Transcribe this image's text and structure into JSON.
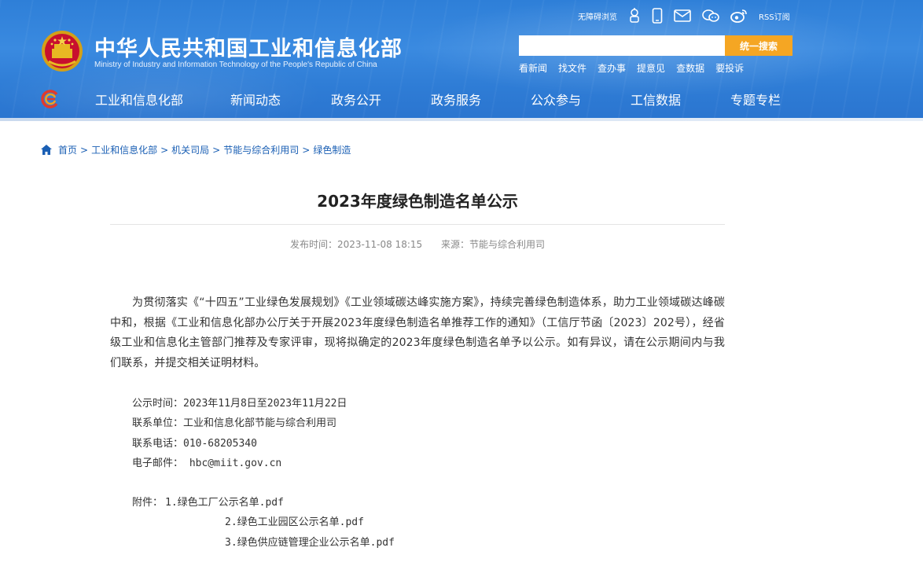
{
  "header": {
    "site_title": "中华人民共和国工业和信息化部",
    "site_subtitle": "Ministry of Industry and Information Technology of the People's Republic of China",
    "toplinks": {
      "accessibility": "无障碍浏览",
      "rss": "RSS订阅"
    },
    "search": {
      "placeholder": "",
      "button_label": "统一搜索"
    },
    "quicklinks": [
      "看新闻",
      "找文件",
      "查办事",
      "提意见",
      "查数据",
      "要投诉"
    ],
    "nav": [
      "工业和信息化部",
      "新闻动态",
      "政务公开",
      "政务服务",
      "公众参与",
      "工信数据",
      "专题专栏"
    ]
  },
  "breadcrumb": [
    "首页",
    "工业和信息化部",
    "机关司局",
    "节能与综合利用司",
    "绿色制造"
  ],
  "breadcrumb_sep": ">",
  "article": {
    "title": "2023年度绿色制造名单公示",
    "publish_time": "发布时间：2023-11-08 18:15",
    "source": "来源：节能与综合利用司",
    "paragraph": "为贯彻落实《“十四五”工业绿色发展规划》《工业领域碳达峰实施方案》，持续完善绿色制造体系，助力工业领域碳达峰碳中和，根据《工业和信息化部办公厅关于开展2023年度绿色制造名单推荐工作的通知》（工信厅节函〔2023〕202号），经省级工业和信息化主管部门推荐及专家评审，现将拟确定的2023年度绿色制造名单予以公示。如有异议，请在公示期间内与我们联系，并提交相关证明材料。",
    "contact": {
      "period": "公示时间：2023年11月8日至2023年11月22日",
      "unit": "联系单位：工业和信息化部节能与综合利用司",
      "phone": "联系电话：010-68205340",
      "email": "电子邮件：  hbc@miit.gov.cn"
    },
    "attachments_label": "附件：",
    "attachments": [
      "1.绿色工厂公示名单.pdf",
      "2.绿色工业园区公示名单.pdf",
      "3.绿色供应链管理企业公示名单.pdf"
    ]
  },
  "colors": {
    "header_blue": "#2e7fd8",
    "search_button": "#f5a623",
    "breadcrumb_link": "#1a5fb4"
  }
}
